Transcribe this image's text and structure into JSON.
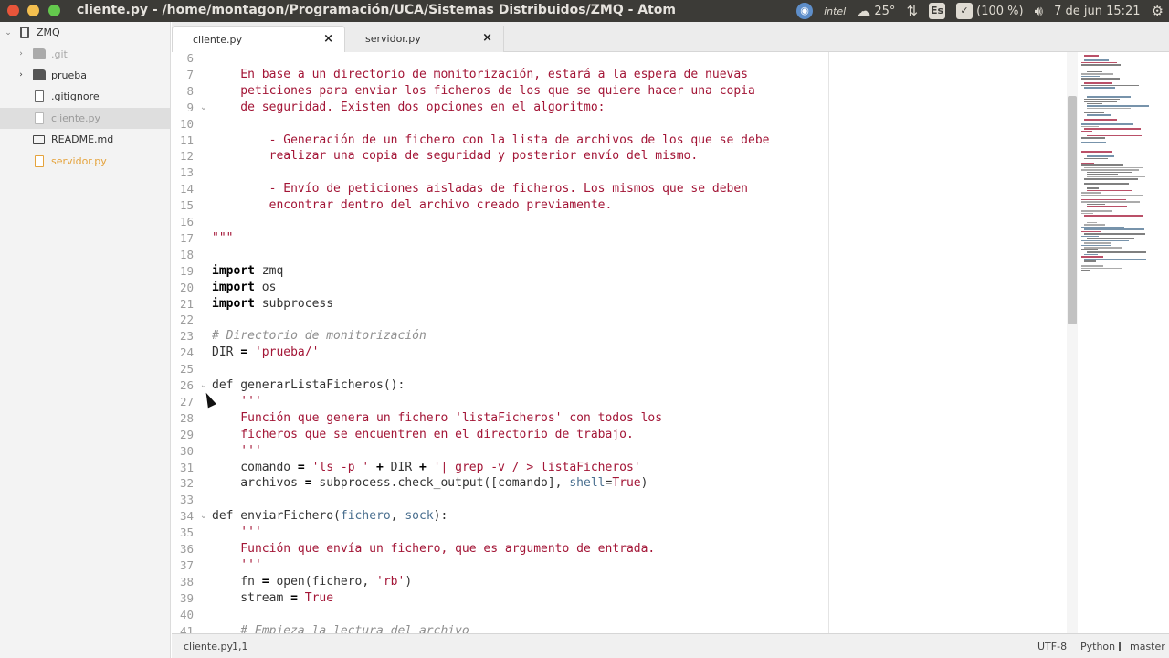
{
  "window": {
    "title": "cliente.py - /home/montagon/Programación/UCA/Sistemas Distribuidos/ZMQ - Atom"
  },
  "tray": {
    "temperature": "25°",
    "keyboard": "Es",
    "battery": "(100 %)",
    "datetime": "7 de jun 15:21",
    "intel_label": "intel"
  },
  "tree": {
    "root": "ZMQ",
    "items": [
      {
        "label": ".git",
        "type": "folder",
        "state": "ignored"
      },
      {
        "label": "prueba",
        "type": "folder",
        "state": "normal"
      },
      {
        "label": ".gitignore",
        "type": "file",
        "state": "normal"
      },
      {
        "label": "cliente.py",
        "type": "file",
        "state": "selected"
      },
      {
        "label": "README.md",
        "type": "book",
        "state": "normal"
      },
      {
        "label": "servidor.py",
        "type": "file",
        "state": "modified"
      }
    ]
  },
  "tabs": [
    {
      "label": "cliente.py",
      "active": true
    },
    {
      "label": "servidor.py",
      "active": false
    }
  ],
  "editor": {
    "first_line": 6,
    "lines": [
      {
        "n": "6",
        "segs": []
      },
      {
        "n": "7",
        "segs": [
          [
            "str",
            "    En base a un directorio de monitorización, estará a la espera de nuevas"
          ]
        ]
      },
      {
        "n": "8",
        "segs": [
          [
            "str",
            "    peticiones para enviar los ficheros de los que se quiere hacer una copia"
          ]
        ]
      },
      {
        "n": "9",
        "fold": true,
        "segs": [
          [
            "str",
            "    de seguridad. Existen dos opciones en el algoritmo:"
          ]
        ]
      },
      {
        "n": "10",
        "segs": []
      },
      {
        "n": "11",
        "segs": [
          [
            "str",
            "        - Generación de un fichero con la lista de archivos de los que se debe"
          ]
        ]
      },
      {
        "n": "12",
        "segs": [
          [
            "str",
            "        realizar una copia de seguridad y posterior envío del mismo."
          ]
        ]
      },
      {
        "n": "13",
        "segs": []
      },
      {
        "n": "14",
        "segs": [
          [
            "str",
            "        - Envío de peticiones aisladas de ficheros. Los mismos que se deben"
          ]
        ]
      },
      {
        "n": "15",
        "segs": [
          [
            "str",
            "        encontrar dentro del archivo creado previamente."
          ]
        ]
      },
      {
        "n": "16",
        "segs": []
      },
      {
        "n": "17",
        "segs": [
          [
            "str",
            "\"\"\""
          ]
        ]
      },
      {
        "n": "18",
        "segs": []
      },
      {
        "n": "19",
        "segs": [
          [
            "kw",
            "import"
          ],
          [
            "plain",
            " zmq"
          ]
        ]
      },
      {
        "n": "20",
        "segs": [
          [
            "kw",
            "import"
          ],
          [
            "plain",
            " os"
          ]
        ]
      },
      {
        "n": "21",
        "segs": [
          [
            "kw",
            "import"
          ],
          [
            "plain",
            " subprocess"
          ]
        ]
      },
      {
        "n": "22",
        "segs": []
      },
      {
        "n": "23",
        "segs": [
          [
            "cmt",
            "# Directorio de monitorización"
          ]
        ]
      },
      {
        "n": "24",
        "segs": [
          [
            "plain",
            "DIR "
          ],
          [
            "op",
            "="
          ],
          [
            "plain",
            " "
          ],
          [
            "str",
            "'prueba/'"
          ]
        ]
      },
      {
        "n": "25",
        "segs": []
      },
      {
        "n": "26",
        "fold": true,
        "segs": [
          [
            "kw2",
            "def"
          ],
          [
            "plain",
            " generarListaFicheros():"
          ]
        ]
      },
      {
        "n": "27",
        "segs": [
          [
            "str",
            "    '''"
          ]
        ]
      },
      {
        "n": "28",
        "segs": [
          [
            "str",
            "    Función que genera un fichero 'listaFicheros' con todos los"
          ]
        ]
      },
      {
        "n": "29",
        "segs": [
          [
            "str",
            "    ficheros que se encuentren en el directorio de trabajo."
          ]
        ]
      },
      {
        "n": "30",
        "segs": [
          [
            "str",
            "    '''"
          ]
        ]
      },
      {
        "n": "31",
        "segs": [
          [
            "plain",
            "    comando "
          ],
          [
            "op",
            "="
          ],
          [
            "plain",
            " "
          ],
          [
            "str",
            "'ls -p '"
          ],
          [
            "plain",
            " "
          ],
          [
            "op",
            "+"
          ],
          [
            "plain",
            " DIR "
          ],
          [
            "op",
            "+"
          ],
          [
            "plain",
            " "
          ],
          [
            "str",
            "'| grep -v / > listaFicheros'"
          ]
        ]
      },
      {
        "n": "32",
        "segs": [
          [
            "plain",
            "    archivos "
          ],
          [
            "op",
            "="
          ],
          [
            "plain",
            " subprocess.check_output([comando], "
          ],
          [
            "param",
            "shell"
          ],
          [
            "plain",
            "="
          ],
          [
            "bool",
            "True"
          ],
          [
            "plain",
            ")"
          ]
        ]
      },
      {
        "n": "33",
        "segs": []
      },
      {
        "n": "34",
        "fold": true,
        "segs": [
          [
            "kw2",
            "def"
          ],
          [
            "plain",
            " enviarFichero("
          ],
          [
            "param",
            "fichero"
          ],
          [
            "plain",
            ", "
          ],
          [
            "param",
            "sock"
          ],
          [
            "plain",
            "):"
          ]
        ]
      },
      {
        "n": "35",
        "segs": [
          [
            "str",
            "    '''"
          ]
        ]
      },
      {
        "n": "36",
        "segs": [
          [
            "str",
            "    Función que envía un fichero, que es argumento de entrada."
          ]
        ]
      },
      {
        "n": "37",
        "segs": [
          [
            "str",
            "    '''"
          ]
        ]
      },
      {
        "n": "38",
        "segs": [
          [
            "plain",
            "    fn "
          ],
          [
            "op",
            "="
          ],
          [
            "plain",
            " open(fichero, "
          ],
          [
            "str",
            "'rb'"
          ],
          [
            "plain",
            ")"
          ]
        ]
      },
      {
        "n": "39",
        "segs": [
          [
            "plain",
            "    stream "
          ],
          [
            "op",
            "="
          ],
          [
            "plain",
            " "
          ],
          [
            "bool",
            "True"
          ]
        ]
      },
      {
        "n": "40",
        "segs": []
      },
      {
        "n": "41",
        "segs": [
          [
            "cmt",
            "    # Empieza la lectura del archivo"
          ]
        ]
      }
    ]
  },
  "statusbar": {
    "file": "cliente.py",
    "cursor": "1,1",
    "encoding": "UTF-8",
    "grammar": "Python",
    "branch": "master"
  },
  "colors": {
    "string": "#a31536",
    "keyword": "#000000",
    "comment": "#8f8f8f",
    "param": "#4a6f8f",
    "modified": "#e5a33c"
  }
}
